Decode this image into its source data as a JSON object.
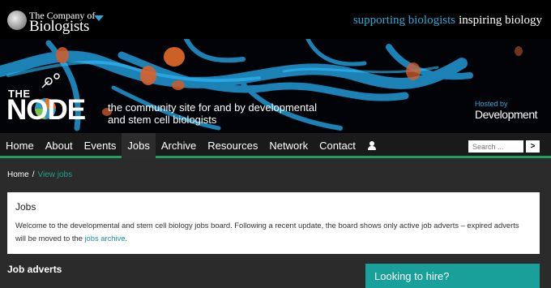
{
  "topbar": {
    "logo_line1": "The Company of",
    "logo_line2": "Biologists",
    "tagline_part1": "supporting biologists",
    "tagline_part2": "inspiring biology"
  },
  "banner": {
    "logo_the": "THE",
    "logo_node": "NODE",
    "description": "the community site for and by developmental and stem cell biologists",
    "hosted_by": "Hosted by",
    "hosted_name": "Development"
  },
  "nav": {
    "items": [
      {
        "label": "Home"
      },
      {
        "label": "About"
      },
      {
        "label": "Events"
      },
      {
        "label": "Jobs"
      },
      {
        "label": "Archive"
      },
      {
        "label": "Resources"
      },
      {
        "label": "Network"
      },
      {
        "label": "Contact"
      }
    ],
    "active_item": "Jobs",
    "user_icon": "user-icon",
    "search_placeholder": "Search ...",
    "search_button": ">"
  },
  "breadcrumb": {
    "home": "Home",
    "separator": "/",
    "current": "View jobs"
  },
  "jobs_box": {
    "title": "Jobs",
    "text_before": "Welcome to the developmental and stem cell biology jobs board. Following a recent update, the board shows only active job adverts – expired adverts will be moved to the ",
    "link": "jobs archive",
    "text_after": "."
  },
  "job_adverts_heading": "Job adverts",
  "hire_box": {
    "title": "Looking to hire?"
  },
  "colors": {
    "accent_blue": "#2ea8d6",
    "nav_underline": "#1fa060",
    "link_teal": "#1fa08a",
    "hire_teal": "#1aa09a"
  }
}
